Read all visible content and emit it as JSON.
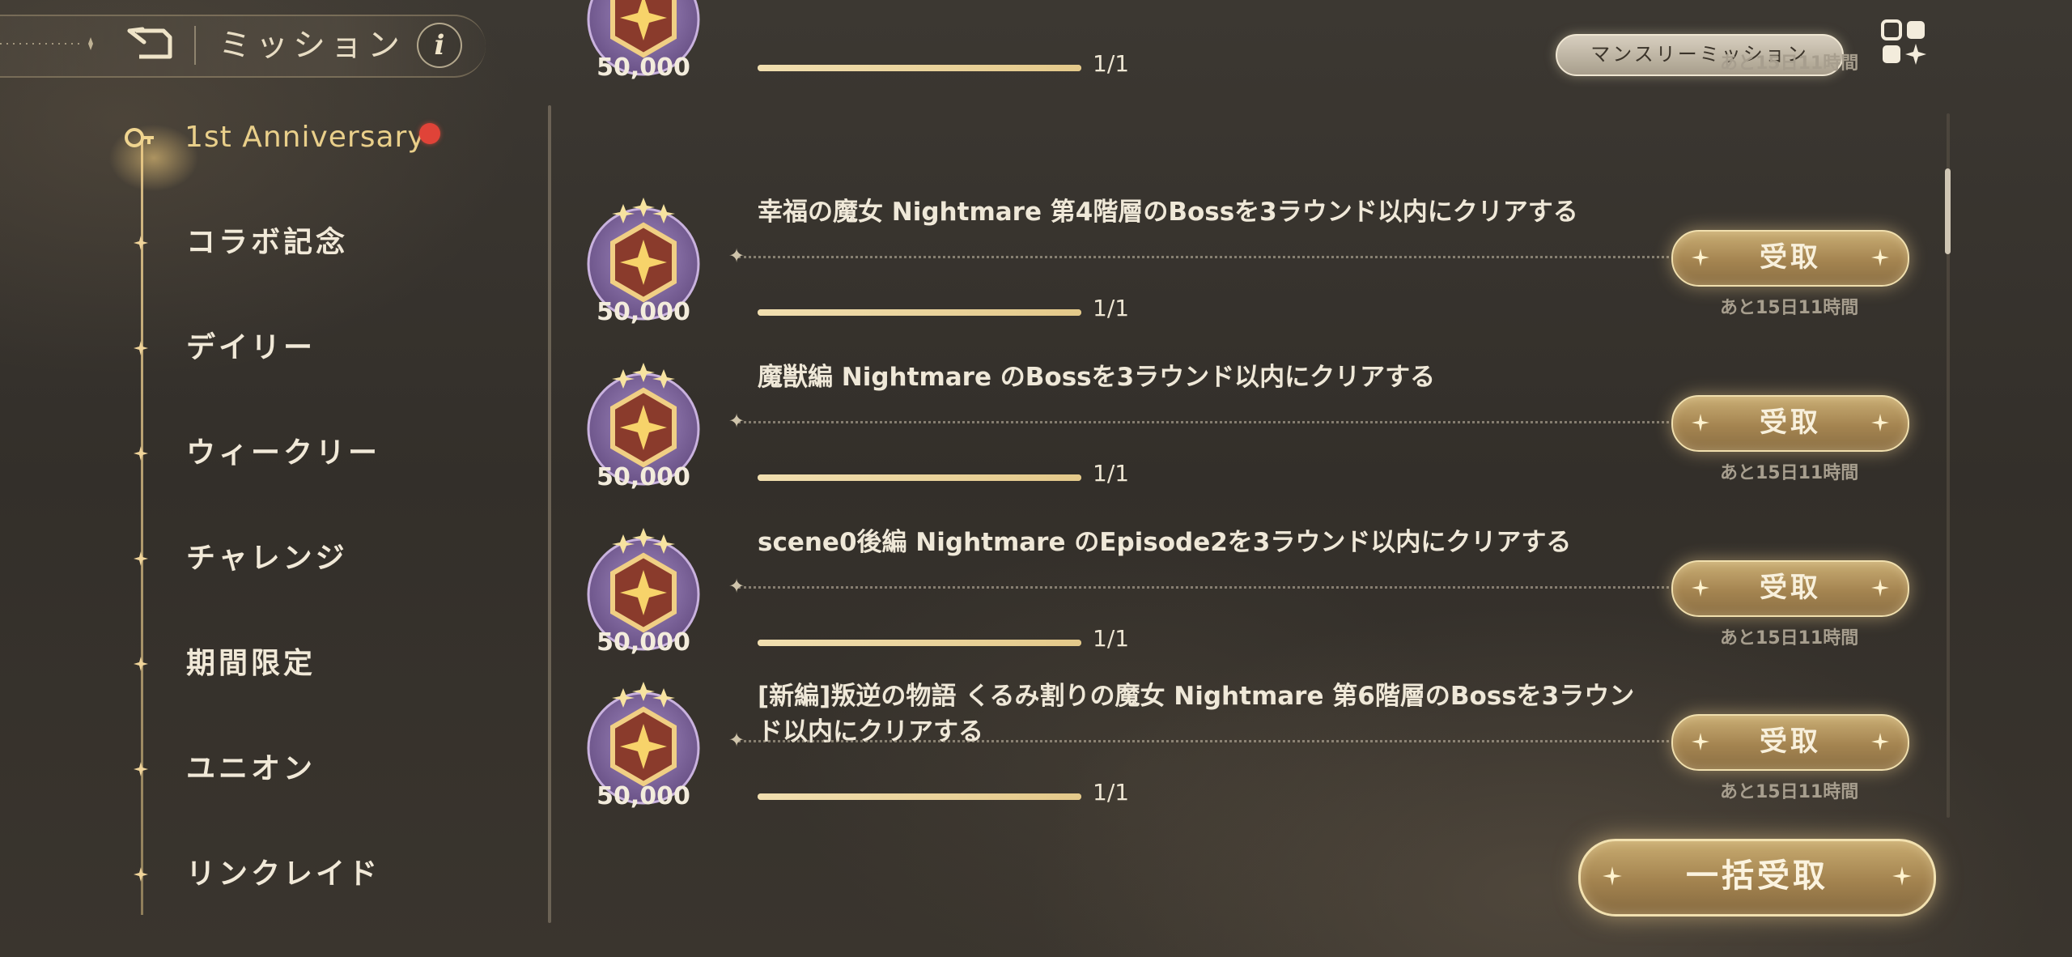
{
  "header": {
    "title": "ミッション",
    "back_icon": "back-arrow-icon",
    "info_label": "i"
  },
  "top_right": {
    "monthly_mission_label": "マンスリーミッション",
    "menu_icon": "grid-menu-icon"
  },
  "sidebar": {
    "items": [
      {
        "label": "1st Anniversary",
        "active": true,
        "has_notification": true
      },
      {
        "label": "コラボ記念"
      },
      {
        "label": "デイリー"
      },
      {
        "label": "ウィークリー"
      },
      {
        "label": "チャレンジ"
      },
      {
        "label": "期間限定"
      },
      {
        "label": "ユニオン"
      },
      {
        "label": "リンクレイド"
      }
    ]
  },
  "missions": [
    {
      "reward": "50,000",
      "text": "",
      "progress_text": "1/1",
      "progress": 1.0,
      "deadline": "あと15日11時間",
      "claim_label": ""
    },
    {
      "reward": "50,000",
      "text": "幸福の魔女 Nightmare 第4階層のBossを3ラウンド以内にクリアする",
      "progress_text": "1/1",
      "progress": 1.0,
      "deadline": "あと15日11時間",
      "claim_label": "受取"
    },
    {
      "reward": "50,000",
      "text": "魔獣編 Nightmare のBossを3ラウンド以内にクリアする",
      "progress_text": "1/1",
      "progress": 1.0,
      "deadline": "あと15日11時間",
      "claim_label": "受取"
    },
    {
      "reward": "50,000",
      "text": "scene0後編 Nightmare のEpisode2を3ラウンド以内にクリアする",
      "progress_text": "1/1",
      "progress": 1.0,
      "deadline": "あと15日11時間",
      "claim_label": "受取"
    },
    {
      "reward": "50,000",
      "text": "[新編]叛逆の物語 くるみ割りの魔女 Nightmare 第6階層のBossを3ラウンド以内にクリアする",
      "progress_text": "1/1",
      "progress": 1.0,
      "deadline": "あと15日11時間",
      "claim_label": "受取"
    }
  ],
  "footer": {
    "claim_all_label": "一括受取"
  },
  "colors": {
    "accent_gold": "#e9cf8a",
    "notification": "#e04338",
    "background": "#36322c"
  }
}
